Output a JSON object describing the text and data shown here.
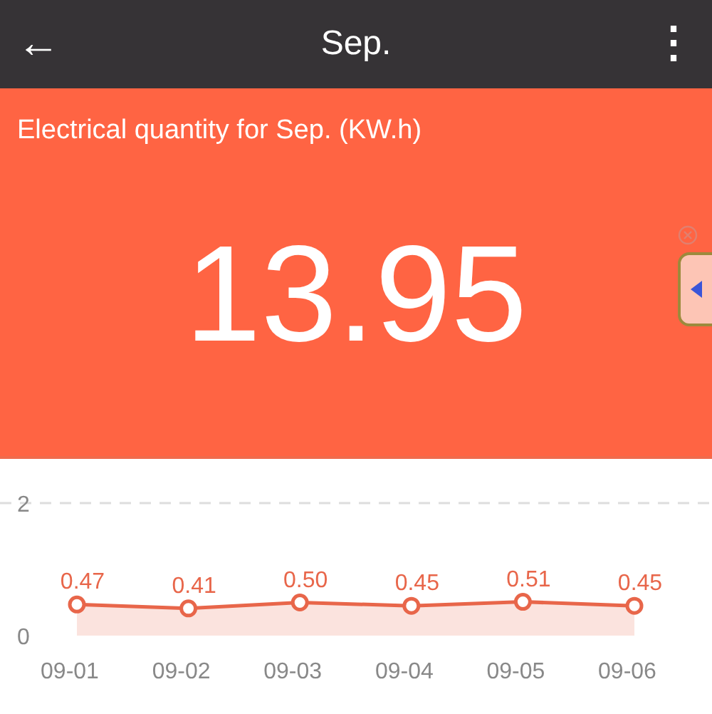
{
  "app_bar": {
    "back_icon": "←",
    "title": "Sep.",
    "menu_icon": "⋮"
  },
  "summary": {
    "label": "Electrical quantity for Sep. (KW.h)",
    "value": "13.95"
  },
  "chart": {
    "chart_data": {
      "type": "area",
      "categories": [
        "09-01",
        "09-02",
        "09-03",
        "09-04",
        "09-05",
        "09-06"
      ],
      "values": [
        0.47,
        0.41,
        0.5,
        0.45,
        0.51,
        0.45
      ],
      "ylim": [
        0,
        2
      ],
      "yticks": [
        0,
        2
      ],
      "value_labels": [
        "0.47",
        "0.41",
        "0.50",
        "0.45",
        "0.51",
        "0.45"
      ],
      "color": "#e8664a"
    }
  }
}
